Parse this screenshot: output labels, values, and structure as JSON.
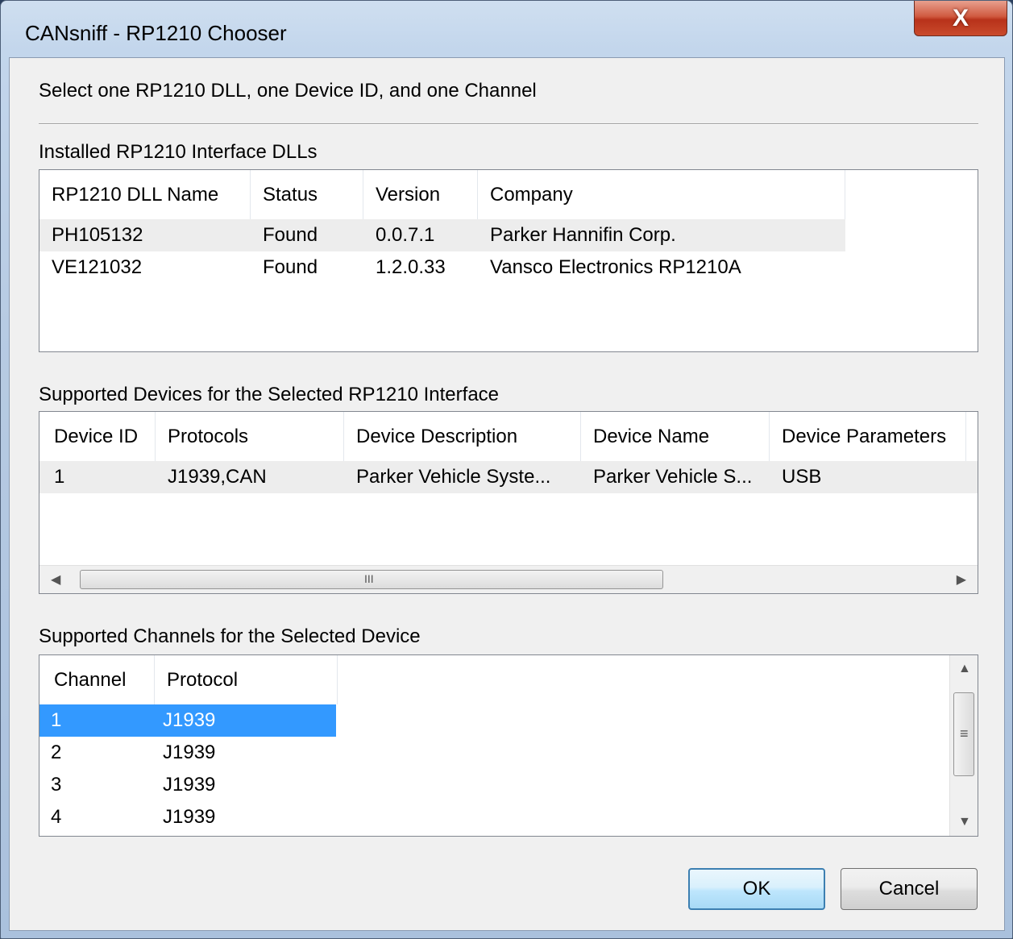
{
  "window": {
    "title": "CANsniff - RP1210 Chooser",
    "close_glyph": "X"
  },
  "instruction": "Select one RP1210 DLL, one Device ID, and one Channel",
  "dlls": {
    "label": "Installed RP1210 Interface DLLs",
    "columns": [
      "RP1210 DLL Name",
      "Status",
      "Version",
      "Company"
    ],
    "rows": [
      [
        "PH105132",
        "Found",
        "0.0.7.1",
        "Parker Hannifin Corp."
      ],
      [
        "VE121032",
        "Found",
        "1.2.0.33",
        "Vansco Electronics RP1210A"
      ]
    ]
  },
  "devices": {
    "label": "Supported Devices for the Selected RP1210 Interface",
    "columns": [
      "Device ID",
      "Protocols",
      "Device Description",
      "Device Name",
      "Device Parameters"
    ],
    "rows": [
      [
        "1",
        "J1939,CAN",
        "Parker Vehicle Syste...",
        "Parker Vehicle S...",
        "USB"
      ]
    ],
    "scroll_grip": "III"
  },
  "channels": {
    "label": "Supported Channels for the Selected Device",
    "columns": [
      "Channel",
      "Protocol"
    ],
    "rows": [
      [
        "1",
        "J1939"
      ],
      [
        "2",
        "J1939"
      ],
      [
        "3",
        "J1939"
      ],
      [
        "4",
        "J1939"
      ]
    ],
    "selected_index": 0,
    "scroll_grip": "≡"
  },
  "buttons": {
    "ok": "OK",
    "cancel": "Cancel"
  }
}
